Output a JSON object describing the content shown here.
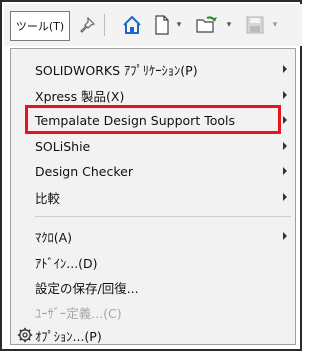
{
  "toolbar": {
    "tool_menu_label": "ツール(T)",
    "icons": [
      "pin-icon",
      "home-icon",
      "new-document-icon",
      "open-folder-icon",
      "save-icon"
    ]
  },
  "menu": {
    "items": [
      {
        "label": "SOLIDWORKS ｱﾌﾟﾘｹｰｼｮﾝ(P)",
        "submenu": true
      },
      {
        "label": "Xpress 製品(X)",
        "submenu": true
      },
      {
        "label": "Tempalate Design Support Tools",
        "submenu": true
      },
      {
        "label": "SOLiShie",
        "submenu": true
      },
      {
        "label": "Design Checker",
        "submenu": true
      },
      {
        "label": "比較",
        "submenu": true
      },
      {
        "label": "ﾏｸﾛ(A)",
        "submenu": true
      },
      {
        "label": "ｱﾄﾞｲﾝ...(D)",
        "submenu": false
      },
      {
        "label": "設定の保存/回復...",
        "submenu": false
      },
      {
        "label": "ﾕｰｻﾞｰ定義...(C)",
        "submenu": false,
        "disabled": true
      },
      {
        "label": "ｵﾌﾟｼｮﾝ...(P)",
        "submenu": false,
        "icon": "gear-icon"
      }
    ],
    "highlight_color": "#e8141b"
  }
}
